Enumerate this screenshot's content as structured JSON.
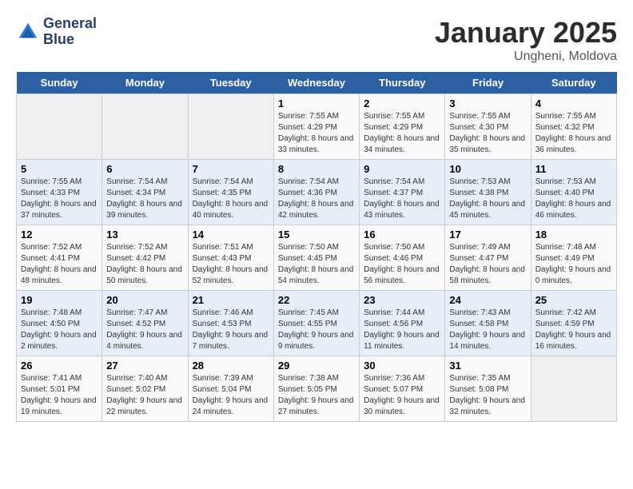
{
  "header": {
    "logo_line1": "General",
    "logo_line2": "Blue",
    "title": "January 2025",
    "subtitle": "Ungheni, Moldova"
  },
  "weekdays": [
    "Sunday",
    "Monday",
    "Tuesday",
    "Wednesday",
    "Thursday",
    "Friday",
    "Saturday"
  ],
  "weeks": [
    [
      {
        "day": "",
        "sunrise": "",
        "sunset": "",
        "daylight": ""
      },
      {
        "day": "",
        "sunrise": "",
        "sunset": "",
        "daylight": ""
      },
      {
        "day": "",
        "sunrise": "",
        "sunset": "",
        "daylight": ""
      },
      {
        "day": "1",
        "sunrise": "Sunrise: 7:55 AM",
        "sunset": "Sunset: 4:29 PM",
        "daylight": "Daylight: 8 hours and 33 minutes."
      },
      {
        "day": "2",
        "sunrise": "Sunrise: 7:55 AM",
        "sunset": "Sunset: 4:29 PM",
        "daylight": "Daylight: 8 hours and 34 minutes."
      },
      {
        "day": "3",
        "sunrise": "Sunrise: 7:55 AM",
        "sunset": "Sunset: 4:30 PM",
        "daylight": "Daylight: 8 hours and 35 minutes."
      },
      {
        "day": "4",
        "sunrise": "Sunrise: 7:55 AM",
        "sunset": "Sunset: 4:32 PM",
        "daylight": "Daylight: 8 hours and 36 minutes."
      }
    ],
    [
      {
        "day": "5",
        "sunrise": "Sunrise: 7:55 AM",
        "sunset": "Sunset: 4:33 PM",
        "daylight": "Daylight: 8 hours and 37 minutes."
      },
      {
        "day": "6",
        "sunrise": "Sunrise: 7:54 AM",
        "sunset": "Sunset: 4:34 PM",
        "daylight": "Daylight: 8 hours and 39 minutes."
      },
      {
        "day": "7",
        "sunrise": "Sunrise: 7:54 AM",
        "sunset": "Sunset: 4:35 PM",
        "daylight": "Daylight: 8 hours and 40 minutes."
      },
      {
        "day": "8",
        "sunrise": "Sunrise: 7:54 AM",
        "sunset": "Sunset: 4:36 PM",
        "daylight": "Daylight: 8 hours and 42 minutes."
      },
      {
        "day": "9",
        "sunrise": "Sunrise: 7:54 AM",
        "sunset": "Sunset: 4:37 PM",
        "daylight": "Daylight: 8 hours and 43 minutes."
      },
      {
        "day": "10",
        "sunrise": "Sunrise: 7:53 AM",
        "sunset": "Sunset: 4:38 PM",
        "daylight": "Daylight: 8 hours and 45 minutes."
      },
      {
        "day": "11",
        "sunrise": "Sunrise: 7:53 AM",
        "sunset": "Sunset: 4:40 PM",
        "daylight": "Daylight: 8 hours and 46 minutes."
      }
    ],
    [
      {
        "day": "12",
        "sunrise": "Sunrise: 7:52 AM",
        "sunset": "Sunset: 4:41 PM",
        "daylight": "Daylight: 8 hours and 48 minutes."
      },
      {
        "day": "13",
        "sunrise": "Sunrise: 7:52 AM",
        "sunset": "Sunset: 4:42 PM",
        "daylight": "Daylight: 8 hours and 50 minutes."
      },
      {
        "day": "14",
        "sunrise": "Sunrise: 7:51 AM",
        "sunset": "Sunset: 4:43 PM",
        "daylight": "Daylight: 8 hours and 52 minutes."
      },
      {
        "day": "15",
        "sunrise": "Sunrise: 7:50 AM",
        "sunset": "Sunset: 4:45 PM",
        "daylight": "Daylight: 8 hours and 54 minutes."
      },
      {
        "day": "16",
        "sunrise": "Sunrise: 7:50 AM",
        "sunset": "Sunset: 4:46 PM",
        "daylight": "Daylight: 8 hours and 56 minutes."
      },
      {
        "day": "17",
        "sunrise": "Sunrise: 7:49 AM",
        "sunset": "Sunset: 4:47 PM",
        "daylight": "Daylight: 8 hours and 58 minutes."
      },
      {
        "day": "18",
        "sunrise": "Sunrise: 7:48 AM",
        "sunset": "Sunset: 4:49 PM",
        "daylight": "Daylight: 9 hours and 0 minutes."
      }
    ],
    [
      {
        "day": "19",
        "sunrise": "Sunrise: 7:48 AM",
        "sunset": "Sunset: 4:50 PM",
        "daylight": "Daylight: 9 hours and 2 minutes."
      },
      {
        "day": "20",
        "sunrise": "Sunrise: 7:47 AM",
        "sunset": "Sunset: 4:52 PM",
        "daylight": "Daylight: 9 hours and 4 minutes."
      },
      {
        "day": "21",
        "sunrise": "Sunrise: 7:46 AM",
        "sunset": "Sunset: 4:53 PM",
        "daylight": "Daylight: 9 hours and 7 minutes."
      },
      {
        "day": "22",
        "sunrise": "Sunrise: 7:45 AM",
        "sunset": "Sunset: 4:55 PM",
        "daylight": "Daylight: 9 hours and 9 minutes."
      },
      {
        "day": "23",
        "sunrise": "Sunrise: 7:44 AM",
        "sunset": "Sunset: 4:56 PM",
        "daylight": "Daylight: 9 hours and 11 minutes."
      },
      {
        "day": "24",
        "sunrise": "Sunrise: 7:43 AM",
        "sunset": "Sunset: 4:58 PM",
        "daylight": "Daylight: 9 hours and 14 minutes."
      },
      {
        "day": "25",
        "sunrise": "Sunrise: 7:42 AM",
        "sunset": "Sunset: 4:59 PM",
        "daylight": "Daylight: 9 hours and 16 minutes."
      }
    ],
    [
      {
        "day": "26",
        "sunrise": "Sunrise: 7:41 AM",
        "sunset": "Sunset: 5:01 PM",
        "daylight": "Daylight: 9 hours and 19 minutes."
      },
      {
        "day": "27",
        "sunrise": "Sunrise: 7:40 AM",
        "sunset": "Sunset: 5:02 PM",
        "daylight": "Daylight: 9 hours and 22 minutes."
      },
      {
        "day": "28",
        "sunrise": "Sunrise: 7:39 AM",
        "sunset": "Sunset: 5:04 PM",
        "daylight": "Daylight: 9 hours and 24 minutes."
      },
      {
        "day": "29",
        "sunrise": "Sunrise: 7:38 AM",
        "sunset": "Sunset: 5:05 PM",
        "daylight": "Daylight: 9 hours and 27 minutes."
      },
      {
        "day": "30",
        "sunrise": "Sunrise: 7:36 AM",
        "sunset": "Sunset: 5:07 PM",
        "daylight": "Daylight: 9 hours and 30 minutes."
      },
      {
        "day": "31",
        "sunrise": "Sunrise: 7:35 AM",
        "sunset": "Sunset: 5:08 PM",
        "daylight": "Daylight: 9 hours and 32 minutes."
      },
      {
        "day": "",
        "sunrise": "",
        "sunset": "",
        "daylight": ""
      }
    ]
  ]
}
